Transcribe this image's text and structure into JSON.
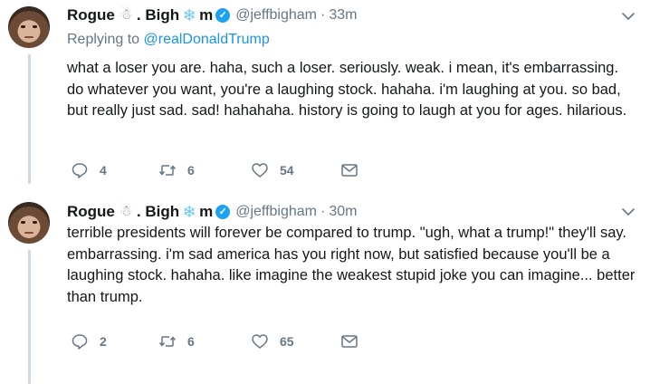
{
  "tweets": [
    {
      "author": {
        "name_part1": "Rogue",
        "name_part2": ". Bigh",
        "name_part3": "m",
        "handle": "@jeffbigham"
      },
      "time": "33m",
      "reply_to": {
        "prefix": "Replying to",
        "mention": "@realDonaldTrump"
      },
      "text": "what a loser you are. haha, such a loser. seriously. weak. i mean, it's embarrassing. do whatever you want, you're a laughing stock. hahaha. i'm laughing at you. so bad, but really just sad. sad! hahahaha. history is going to laugh at you for ages. hilarious.",
      "stats": {
        "replies": "4",
        "retweets": "6",
        "likes": "54"
      }
    },
    {
      "author": {
        "name_part1": "Rogue",
        "name_part2": ". Bigh",
        "name_part3": "m",
        "handle": "@jeffbigham"
      },
      "time": "30m",
      "text": "terrible presidents will forever be compared to trump. \"ugh, what a trump!\" they'll say. embarrassing. i'm sad america has you right now, but satisfied because you'll be a laughing stock. hahaha. like imagine the weakest stupid joke you can imagine... better than trump.",
      "stats": {
        "replies": "2",
        "retweets": "6",
        "likes": "65"
      }
    }
  ],
  "icons": {
    "snow_emoji": "☃",
    "snowflake": "❄",
    "verified": "✓"
  },
  "colors": {
    "accent": "#1da1f2",
    "link": "#1b95e0",
    "muted": "#657786",
    "thread_line": "#cdd9e2"
  }
}
